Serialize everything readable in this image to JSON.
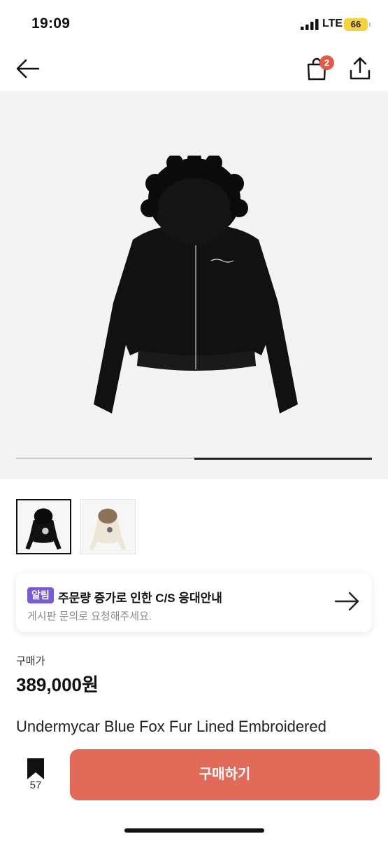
{
  "status_bar": {
    "time": "19:09",
    "network": "LTE",
    "battery": "66",
    "battery_color": "#f4d43a"
  },
  "nav": {
    "back_icon": "arrow-left-icon",
    "cart_icon": "shopping-bag-icon",
    "cart_badge": "2",
    "share_icon": "share-icon"
  },
  "gallery": {
    "image": "black fur-hood zip jacket",
    "current_index": 2,
    "total": 2,
    "progress_fraction": 0.5
  },
  "thumbnails": [
    {
      "name": "black jacket",
      "selected": true
    },
    {
      "name": "cream jacket",
      "selected": false
    }
  ],
  "notice": {
    "tag": "알림",
    "title": "주문량 증가로 인한 C/S 응대안내",
    "subtitle": "게시판 문의로 요청해주세요.",
    "tag_color": "#7a5bd6"
  },
  "price": {
    "label": "구매가",
    "value": "389,000원"
  },
  "product": {
    "title": "Undermycar Blue Fox Fur Lined Embroidered"
  },
  "bottom_bar": {
    "bookmark_count": "57",
    "buy_label": "구매하기",
    "buy_color": "#e16a58"
  }
}
